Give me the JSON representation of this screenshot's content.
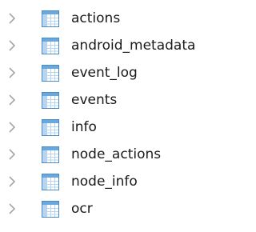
{
  "tree": {
    "items": [
      {
        "label": "actions",
        "icon": "table-icon",
        "expander": "chevron-right-icon"
      },
      {
        "label": "android_metadata",
        "icon": "table-icon",
        "expander": "chevron-right-icon"
      },
      {
        "label": "event_log",
        "icon": "table-icon",
        "expander": "chevron-right-icon"
      },
      {
        "label": "events",
        "icon": "table-icon",
        "expander": "chevron-right-icon"
      },
      {
        "label": "info",
        "icon": "table-icon",
        "expander": "chevron-right-icon"
      },
      {
        "label": "node_actions",
        "icon": "table-icon",
        "expander": "chevron-right-icon"
      },
      {
        "label": "node_info",
        "icon": "table-icon",
        "expander": "chevron-right-icon"
      },
      {
        "label": "ocr",
        "icon": "table-icon",
        "expander": "chevron-right-icon"
      }
    ]
  },
  "colors": {
    "chevron": "#a6a6a6",
    "table_border": "#4a8bc9",
    "table_header": "#6aa7dc",
    "table_cell": "#ffffff",
    "table_grid": "#b8d4ee",
    "text": "#1a1a1a"
  }
}
